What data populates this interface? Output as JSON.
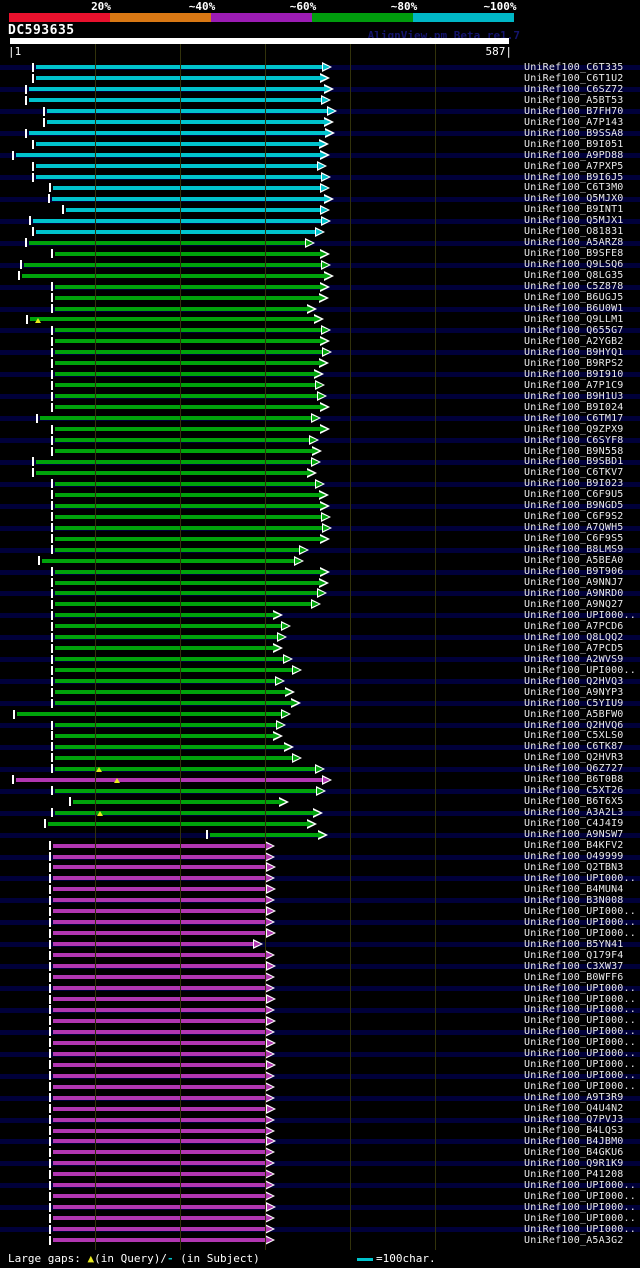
{
  "header": {
    "identity_scale": {
      "bins": [
        {
          "label": "20%",
          "color": "#e8112d"
        },
        {
          "label": "~40%",
          "color": "#d97814"
        },
        {
          "label": "~60%",
          "color": "#9c1cb4"
        },
        {
          "label": "~80%",
          "color": "#009c0d"
        },
        {
          "label": "~100%",
          "color": "#00b7c6"
        }
      ]
    },
    "query_id": "DC593635",
    "watermark": "AlignView.pm Beta re1.7",
    "ruler": {
      "start_text": "|1",
      "end_text": "587|",
      "start": 1,
      "end": 587,
      "tick_interval": 100
    }
  },
  "legend": {
    "prefix": "Large gaps: ",
    "query_gap_symbol": "▲",
    "query_gap_text": "(in Query)/",
    "subject_gap_symbol": "-",
    "subject_gap_text": " (in Subject)",
    "scale_bar_label": "=100char."
  },
  "colors": {
    "cyan": "#00c3cd",
    "green": "#00a30b",
    "magenta": "#b136b1",
    "background": "#000000",
    "stripe": "#00003a",
    "gridline": "#32320b",
    "query_bar": "#ffffff",
    "label_text": "#e9e9e9",
    "gap_triangle": "#e8e81e"
  },
  "chart_data": {
    "type": "bar",
    "orientation": "horizontal-alignment-spans",
    "title": "DC593635",
    "x_axis": {
      "min": 1,
      "max": 587,
      "tick_interval": 100,
      "unit": "residues"
    },
    "identity_legend": [
      "20%",
      "~40%",
      "~60%",
      "~80%",
      "~100%"
    ],
    "rows": [
      {
        "label": "UniRef100_C6T335",
        "color": "cyan",
        "start": 31,
        "end": 379
      },
      {
        "label": "UniRef100_C6T1U2",
        "color": "cyan",
        "start": 31,
        "end": 376
      },
      {
        "label": "UniRef100_C6SZ72",
        "color": "cyan",
        "start": 22,
        "end": 381
      },
      {
        "label": "UniRef100_A5BT53",
        "color": "cyan",
        "start": 22,
        "end": 378
      },
      {
        "label": "UniRef100_B7FH70",
        "color": "cyan",
        "start": 44,
        "end": 385
      },
      {
        "label": "UniRef100_A7P143",
        "color": "cyan",
        "start": 44,
        "end": 381
      },
      {
        "label": "UniRef100_B9SSA8",
        "color": "cyan",
        "start": 22,
        "end": 382
      },
      {
        "label": "UniRef100_B9I051",
        "color": "cyan",
        "start": 31,
        "end": 375
      },
      {
        "label": "UniRef100_A9PD88",
        "color": "cyan",
        "start": 7,
        "end": 376
      },
      {
        "label": "UniRef100_A7PXP5",
        "color": "cyan",
        "start": 31,
        "end": 373
      },
      {
        "label": "UniRef100_B9I6J5",
        "color": "cyan",
        "start": 31,
        "end": 378
      },
      {
        "label": "UniRef100_C6T3M0",
        "color": "cyan",
        "start": 50,
        "end": 377
      },
      {
        "label": "UniRef100_Q5MJX0",
        "color": "cyan",
        "start": 49,
        "end": 381
      },
      {
        "label": "UniRef100_B9INT1",
        "color": "cyan",
        "start": 66,
        "end": 377
      },
      {
        "label": "UniRef100_Q5MJX1",
        "color": "cyan",
        "start": 27,
        "end": 378
      },
      {
        "label": "UniRef100_O81831",
        "color": "cyan",
        "start": 31,
        "end": 371
      },
      {
        "label": "UniRef100_A5ARZ8",
        "color": "green",
        "start": 22,
        "end": 359
      },
      {
        "label": "UniRef100_B9SFE8",
        "color": "green",
        "start": 53,
        "end": 376
      },
      {
        "label": "UniRef100_Q9LSQ6",
        "color": "green",
        "start": 16,
        "end": 378
      },
      {
        "label": "UniRef100_Q8LG35",
        "color": "green",
        "start": 14,
        "end": 381
      },
      {
        "label": "UniRef100_C5Z878",
        "color": "green",
        "start": 53,
        "end": 376
      },
      {
        "label": "UniRef100_B6UGJ5",
        "color": "green",
        "start": 53,
        "end": 375
      },
      {
        "label": "UniRef100_B6U0W1",
        "color": "green",
        "start": 53,
        "end": 361
      },
      {
        "label": "UniRef100_Q9LLM1",
        "color": "green",
        "start": 24,
        "end": 369,
        "gaps_query": [
          33
        ]
      },
      {
        "label": "UniRef100_Q655G7",
        "color": "green",
        "start": 53,
        "end": 378
      },
      {
        "label": "UniRef100_A2YGB2",
        "color": "green",
        "start": 53,
        "end": 376
      },
      {
        "label": "UniRef100_B9HYQ1",
        "color": "green",
        "start": 53,
        "end": 379
      },
      {
        "label": "UniRef100_B9RPS2",
        "color": "green",
        "start": 53,
        "end": 375
      },
      {
        "label": "UniRef100_B9I910",
        "color": "green",
        "start": 53,
        "end": 369
      },
      {
        "label": "UniRef100_A7P1C9",
        "color": "green",
        "start": 53,
        "end": 371
      },
      {
        "label": "UniRef100_B9H1U3",
        "color": "green",
        "start": 53,
        "end": 373
      },
      {
        "label": "UniRef100_B9I024",
        "color": "green",
        "start": 53,
        "end": 376
      },
      {
        "label": "UniRef100_C6TM17",
        "color": "green",
        "start": 35,
        "end": 366
      },
      {
        "label": "UniRef100_Q9ZPX9",
        "color": "green",
        "start": 53,
        "end": 376
      },
      {
        "label": "UniRef100_C6SYF8",
        "color": "green",
        "start": 53,
        "end": 364
      },
      {
        "label": "UniRef100_B9N558",
        "color": "green",
        "start": 53,
        "end": 367
      },
      {
        "label": "UniRef100_B9SBD1",
        "color": "green",
        "start": 31,
        "end": 366
      },
      {
        "label": "UniRef100_C6TKV7",
        "color": "green",
        "start": 31,
        "end": 361
      },
      {
        "label": "UniRef100_B9I023",
        "color": "green",
        "start": 53,
        "end": 371
      },
      {
        "label": "UniRef100_C6F9U5",
        "color": "green",
        "start": 53,
        "end": 375
      },
      {
        "label": "UniRef100_B9NGD5",
        "color": "green",
        "start": 53,
        "end": 376
      },
      {
        "label": "UniRef100_C6F9S2",
        "color": "green",
        "start": 53,
        "end": 378
      },
      {
        "label": "UniRef100_A7QWH5",
        "color": "green",
        "start": 53,
        "end": 379
      },
      {
        "label": "UniRef100_C6F9S5",
        "color": "green",
        "start": 53,
        "end": 376
      },
      {
        "label": "UniRef100_B8LMS9",
        "color": "green",
        "start": 53,
        "end": 352
      },
      {
        "label": "UniRef100_A5BEA0",
        "color": "green",
        "start": 38,
        "end": 346
      },
      {
        "label": "UniRef100_B9T906",
        "color": "green",
        "start": 53,
        "end": 376
      },
      {
        "label": "UniRef100_A9NNJ7",
        "color": "green",
        "start": 53,
        "end": 375
      },
      {
        "label": "UniRef100_A9NRD0",
        "color": "green",
        "start": 53,
        "end": 373
      },
      {
        "label": "UniRef100_A9NQ27",
        "color": "green",
        "start": 53,
        "end": 366
      },
      {
        "label": "UniRef100_UPI000..",
        "color": "green",
        "start": 53,
        "end": 321
      },
      {
        "label": "UniRef100_A7PCD6",
        "color": "green",
        "start": 53,
        "end": 331
      },
      {
        "label": "UniRef100_Q8LQQ2",
        "color": "green",
        "start": 53,
        "end": 326
      },
      {
        "label": "UniRef100_A7PCD5",
        "color": "green",
        "start": 53,
        "end": 321
      },
      {
        "label": "UniRef100_A2WVS9",
        "color": "green",
        "start": 53,
        "end": 333
      },
      {
        "label": "UniRef100_UPI000..",
        "color": "green",
        "start": 53,
        "end": 344
      },
      {
        "label": "UniRef100_Q2HVQ3",
        "color": "green",
        "start": 53,
        "end": 324
      },
      {
        "label": "UniRef100_A9NYP3",
        "color": "green",
        "start": 53,
        "end": 335
      },
      {
        "label": "UniRef100_C5YIU9",
        "color": "green",
        "start": 53,
        "end": 342
      },
      {
        "label": "UniRef100_A5BFW0",
        "color": "green",
        "start": 8,
        "end": 331
      },
      {
        "label": "UniRef100_Q2HVQ6",
        "color": "green",
        "start": 53,
        "end": 325
      },
      {
        "label": "UniRef100_C5XLS0",
        "color": "green",
        "start": 53,
        "end": 321
      },
      {
        "label": "UniRef100_C6TK87",
        "color": "green",
        "start": 53,
        "end": 334
      },
      {
        "label": "UniRef100_Q2HVR3",
        "color": "green",
        "start": 53,
        "end": 344
      },
      {
        "label": "UniRef100_Q6Z727",
        "color": "green",
        "start": 53,
        "end": 371,
        "gaps_query": [
          105
        ]
      },
      {
        "label": "UniRef100_B6T0B8",
        "color": "magenta",
        "start": 7,
        "end": 379,
        "gaps_query": [
          126
        ]
      },
      {
        "label": "UniRef100_C5XT26",
        "color": "green",
        "start": 53,
        "end": 372
      },
      {
        "label": "UniRef100_B6T6X5",
        "color": "green",
        "start": 74,
        "end": 328
      },
      {
        "label": "UniRef100_A3A2L3",
        "color": "green",
        "start": 53,
        "end": 368,
        "gaps_query": [
          106
        ]
      },
      {
        "label": "UniRef100_C4J4I9",
        "color": "green",
        "start": 45,
        "end": 361
      },
      {
        "label": "UniRef100_A9NSW7",
        "color": "green",
        "start": 235,
        "end": 374
      },
      {
        "label": "UniRef100_B4KFV2",
        "color": "magenta",
        "start": 51,
        "end": 312
      },
      {
        "label": "UniRef100_O49999",
        "color": "magenta",
        "start": 51,
        "end": 312
      },
      {
        "label": "UniRef100_Q2TBN3",
        "color": "magenta",
        "start": 51,
        "end": 313
      },
      {
        "label": "UniRef100_UPI000..",
        "color": "magenta",
        "start": 51,
        "end": 312
      },
      {
        "label": "UniRef100_B4MUN4",
        "color": "magenta",
        "start": 51,
        "end": 313
      },
      {
        "label": "UniRef100_B3N008",
        "color": "magenta",
        "start": 51,
        "end": 312
      },
      {
        "label": "UniRef100_UPI000..",
        "color": "magenta",
        "start": 51,
        "end": 313
      },
      {
        "label": "UniRef100_UPI000..",
        "color": "magenta",
        "start": 51,
        "end": 312
      },
      {
        "label": "UniRef100_UPI000..",
        "color": "magenta",
        "start": 51,
        "end": 313
      },
      {
        "label": "UniRef100_B5YN41",
        "color": "magenta",
        "start": 51,
        "end": 298
      },
      {
        "label": "UniRef100_Q179F4",
        "color": "magenta",
        "start": 51,
        "end": 312
      },
      {
        "label": "UniRef100_C3XW37",
        "color": "magenta",
        "start": 51,
        "end": 313
      },
      {
        "label": "UniRef100_B0WFF6",
        "color": "magenta",
        "start": 51,
        "end": 312
      },
      {
        "label": "UniRef100_UPI000..",
        "color": "magenta",
        "start": 51,
        "end": 312
      },
      {
        "label": "UniRef100_UPI000..",
        "color": "magenta",
        "start": 51,
        "end": 313
      },
      {
        "label": "UniRef100_UPI000..",
        "color": "magenta",
        "start": 51,
        "end": 312
      },
      {
        "label": "UniRef100_UPI000..",
        "color": "magenta",
        "start": 51,
        "end": 313
      },
      {
        "label": "UniRef100_UPI000..",
        "color": "magenta",
        "start": 51,
        "end": 312
      },
      {
        "label": "UniRef100_UPI000..",
        "color": "magenta",
        "start": 51,
        "end": 313
      },
      {
        "label": "UniRef100_UPI000..",
        "color": "magenta",
        "start": 51,
        "end": 312
      },
      {
        "label": "UniRef100_UPI000..",
        "color": "magenta",
        "start": 51,
        "end": 313
      },
      {
        "label": "UniRef100_UPI000..",
        "color": "magenta",
        "start": 51,
        "end": 312
      },
      {
        "label": "UniRef100_UPI000..",
        "color": "magenta",
        "start": 51,
        "end": 312
      },
      {
        "label": "UniRef100_A9T3R9",
        "color": "magenta",
        "start": 51,
        "end": 312
      },
      {
        "label": "UniRef100_Q4U4N2",
        "color": "magenta",
        "start": 51,
        "end": 313
      },
      {
        "label": "UniRef100_Q7PVJ3",
        "color": "magenta",
        "start": 51,
        "end": 312
      },
      {
        "label": "UniRef100_B4LQS3",
        "color": "magenta",
        "start": 51,
        "end": 312
      },
      {
        "label": "UniRef100_B4JBM0",
        "color": "magenta",
        "start": 51,
        "end": 313
      },
      {
        "label": "UniRef100_B4GKU6",
        "color": "magenta",
        "start": 51,
        "end": 312
      },
      {
        "label": "UniRef100_Q9R1K9",
        "color": "magenta",
        "start": 51,
        "end": 312
      },
      {
        "label": "UniRef100_P41208",
        "color": "magenta",
        "start": 51,
        "end": 312
      },
      {
        "label": "UniRef100_UPI000..",
        "color": "magenta",
        "start": 51,
        "end": 312
      },
      {
        "label": "UniRef100_UPI000..",
        "color": "magenta",
        "start": 51,
        "end": 312
      },
      {
        "label": "UniRef100_UPI000..",
        "color": "magenta",
        "start": 51,
        "end": 313
      },
      {
        "label": "UniRef100_UPI000..",
        "color": "magenta",
        "start": 51,
        "end": 312
      },
      {
        "label": "UniRef100_UPI000..",
        "color": "magenta",
        "start": 51,
        "end": 312
      },
      {
        "label": "UniRef100_A5A3G2",
        "color": "magenta",
        "start": 51,
        "end": 312
      }
    ]
  }
}
